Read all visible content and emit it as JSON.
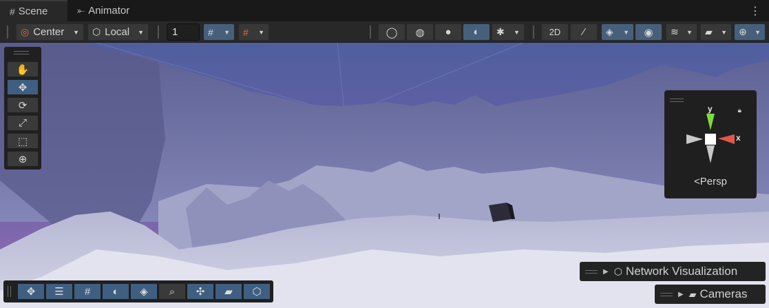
{
  "tabs": [
    {
      "label": "Scene",
      "icon": "grid-icon",
      "active": true
    },
    {
      "label": "Animator",
      "icon": "animator-icon",
      "active": false
    }
  ],
  "toolbar": {
    "pivot_mode": "Center",
    "pivot_rotation": "Local",
    "grid_increment": "1"
  },
  "gizmo": {
    "y_axis": "y",
    "x_axis": "x",
    "projection": "Persp",
    "colors": {
      "y": "#7ddc3a",
      "x": "#e0584a"
    }
  },
  "overlays": {
    "network": "Network Visualization",
    "cameras": "Cameras"
  },
  "colors": {
    "toolbar_bg": "#282828",
    "active_blue": "#3f5f82",
    "sky_top": "#4f5f9e",
    "sky_horizon": "#9a6fb3",
    "terrain": "#c9cbe0"
  }
}
